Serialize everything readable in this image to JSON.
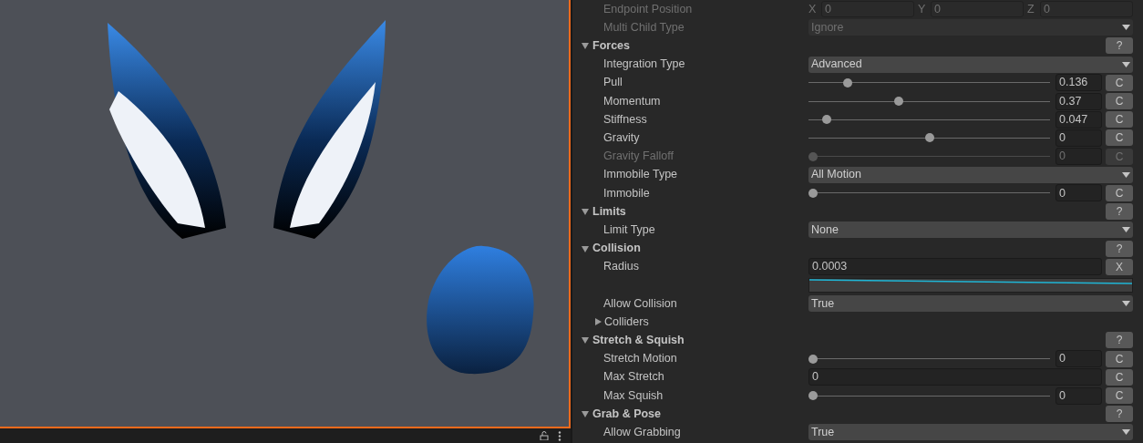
{
  "scene_view": {
    "focused": true
  },
  "inspector": {
    "rows": [
      {
        "kind": "vector3",
        "label": "Endpoint Position",
        "disabled": true,
        "axes": [
          {
            "axis": "X",
            "value": "0"
          },
          {
            "axis": "Y",
            "value": "0"
          },
          {
            "axis": "Z",
            "value": "0"
          }
        ]
      },
      {
        "kind": "dropdown",
        "label": "Multi Child Type",
        "disabled": true,
        "value": "Ignore"
      },
      {
        "kind": "header",
        "label": "Forces",
        "expanded": true,
        "help": "?"
      },
      {
        "kind": "dropdown",
        "label": "Integration Type",
        "disabled": false,
        "value": "Advanced"
      },
      {
        "kind": "slider",
        "label": "Pull",
        "disabled": false,
        "level": 0.15,
        "value": "0.136",
        "button": "C"
      },
      {
        "kind": "slider",
        "label": "Momentum",
        "disabled": false,
        "level": 0.37,
        "value": "0.37",
        "button": "C"
      },
      {
        "kind": "slider",
        "label": "Stiffness",
        "disabled": false,
        "level": 0.06,
        "value": "0.047",
        "button": "C"
      },
      {
        "kind": "slider",
        "label": "Gravity",
        "disabled": false,
        "level": 0.5,
        "value": "0",
        "button": "C"
      },
      {
        "kind": "slider",
        "label": "Gravity Falloff",
        "disabled": true,
        "level": 0,
        "value": "0",
        "button": "C"
      },
      {
        "kind": "dropdown",
        "label": "Immobile Type",
        "disabled": false,
        "value": "All Motion"
      },
      {
        "kind": "slider",
        "label": "Immobile",
        "disabled": false,
        "level": 0,
        "value": "0",
        "button": "C"
      },
      {
        "kind": "header",
        "label": "Limits",
        "expanded": true,
        "help": "?"
      },
      {
        "kind": "dropdown",
        "label": "Limit Type",
        "disabled": false,
        "value": "None"
      },
      {
        "kind": "header",
        "label": "Collision",
        "expanded": true,
        "help": "?"
      },
      {
        "kind": "field",
        "label": "Radius",
        "value": "0.0003",
        "button": "X"
      },
      {
        "kind": "curve"
      },
      {
        "kind": "dropdown",
        "label": "Allow Collision",
        "disabled": false,
        "value": "True"
      },
      {
        "kind": "foldout",
        "label": "Colliders",
        "expanded": false
      },
      {
        "kind": "header",
        "label": "Stretch & Squish",
        "expanded": true,
        "help": "?"
      },
      {
        "kind": "slider",
        "label": "Stretch Motion",
        "disabled": false,
        "level": 0,
        "value": "0",
        "button": "C"
      },
      {
        "kind": "field",
        "label": "Max Stretch",
        "value": "0",
        "button": "C"
      },
      {
        "kind": "slider",
        "label": "Max Squish",
        "disabled": false,
        "level": 0,
        "value": "0",
        "button": "C"
      },
      {
        "kind": "header",
        "label": "Grab & Pose",
        "expanded": true,
        "help": "?"
      },
      {
        "kind": "dropdown",
        "label": "Allow Grabbing",
        "disabled": false,
        "value": "True"
      }
    ]
  }
}
